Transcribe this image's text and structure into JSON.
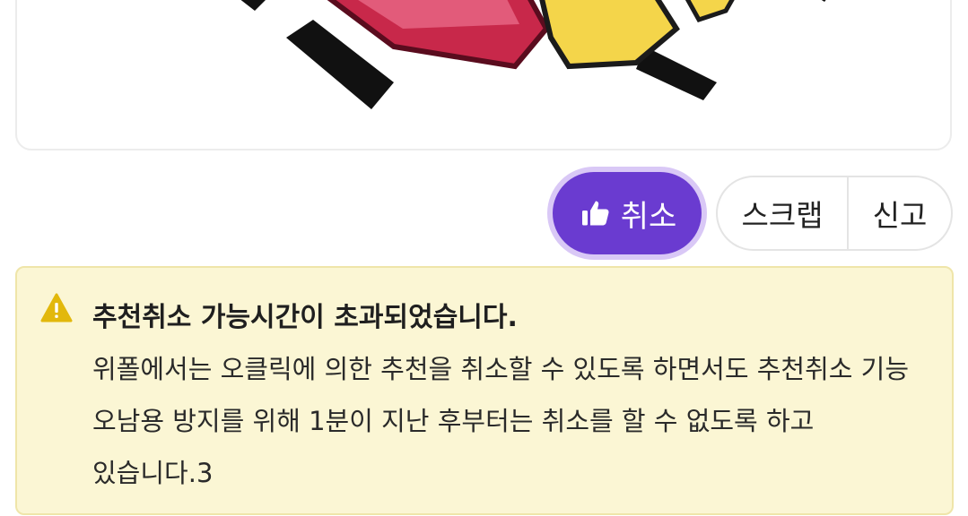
{
  "actions": {
    "recommend_cancel_label": "취소",
    "scrap_label": "스크랩",
    "report_label": "신고"
  },
  "notice": {
    "title": "추천취소 가능시간이 초과되었습니다.",
    "body": "위폴에서는 오클릭에 의한 추천을 취소할 수 있도록 하면서도 추천취소 기능 오남용 방지를 위해 1분이 지난 후부터는 취소를 할 수 없도록 하고 있습니다.3"
  },
  "colors": {
    "accent": "#6a3bd0",
    "accent_glow": "#d9c8f6",
    "notice_bg": "#fbf6d4",
    "warning_icon": "#e2b80c"
  },
  "icons": {
    "recommend": "thumbs-up-icon",
    "notice": "warning-triangle-icon"
  }
}
